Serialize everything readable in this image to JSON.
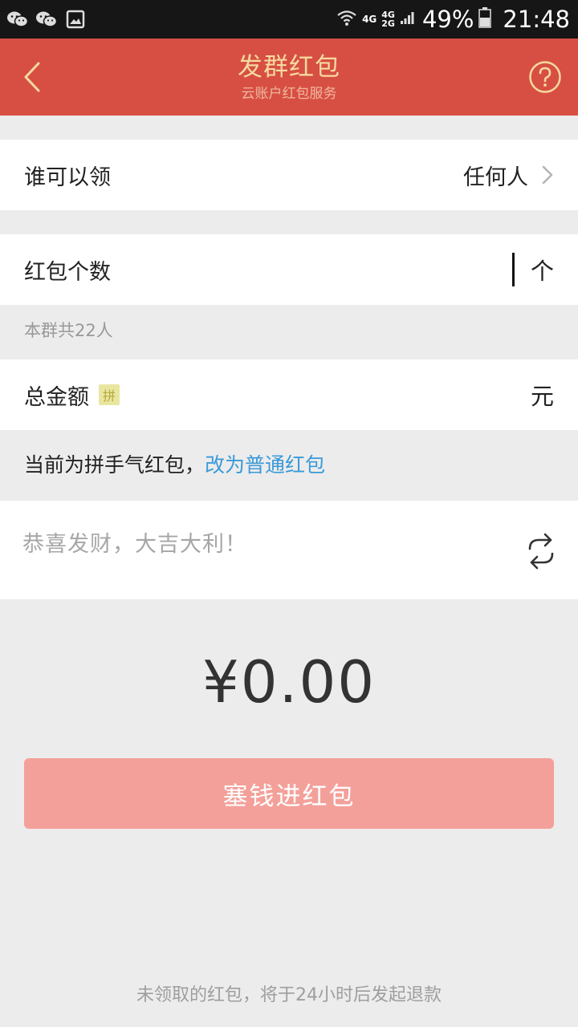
{
  "status_bar": {
    "net_4g": "4G",
    "net_4g_2": "4G",
    "net_2g": "2G",
    "battery": "49%",
    "time": "21:48",
    "icons": [
      "wechat-icon",
      "wechat-icon",
      "image-icon",
      "wifi-icon",
      "signal-icon",
      "battery-icon"
    ]
  },
  "header": {
    "title": "发群红包",
    "subtitle": "云账户红包服务",
    "back_icon": "back-chevron-icon",
    "help_icon": "help-circle-icon"
  },
  "who_can_claim": {
    "label": "谁可以领",
    "value": "任何人"
  },
  "packet_count": {
    "label": "红包个数",
    "unit": "个",
    "value": "",
    "hint": "本群共22人"
  },
  "total_amount": {
    "label": "总金额",
    "badge": "拼",
    "unit": "元",
    "value": ""
  },
  "mode_switch": {
    "current": "当前为拼手气红包，",
    "link": "改为普通红包"
  },
  "greeting": {
    "text": "恭喜发财，大吉大利！",
    "refresh_icon": "refresh-icon"
  },
  "amount_display": "¥0.00",
  "submit_button": "塞钱进红包",
  "footer_note": "未领取的红包，将于24小时后发起退款",
  "colors": {
    "header_bg": "#d74f43",
    "header_title": "#f6d99f",
    "link": "#3a9ad9",
    "button_bg": "#f4a09a",
    "page_bg": "#ececec"
  }
}
